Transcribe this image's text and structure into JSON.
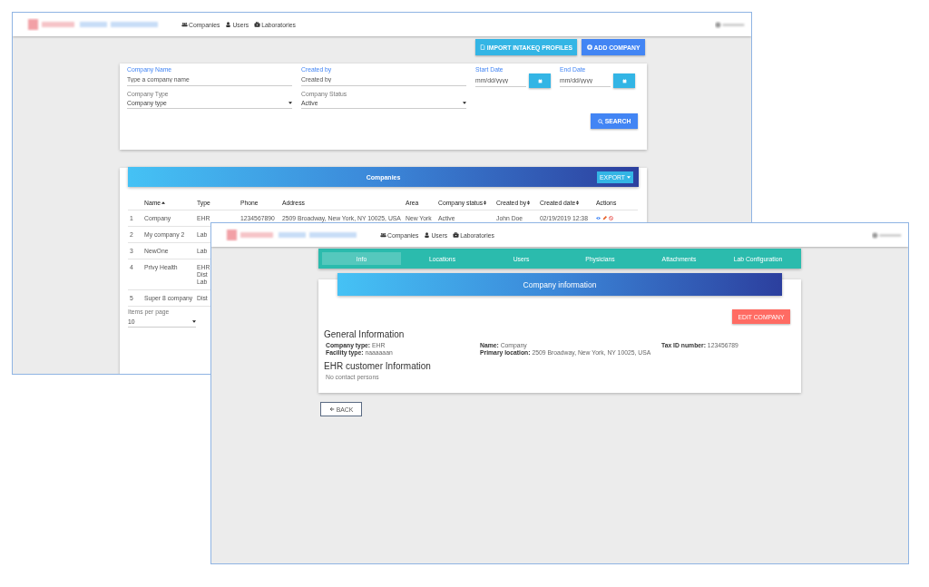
{
  "back_window": {
    "nav": {
      "items": [
        {
          "label": "Companies"
        },
        {
          "label": "Users"
        },
        {
          "label": "Laboratories"
        }
      ]
    },
    "toolbar_buttons": [
      {
        "label": "IMPORT INTAKEQ PROFILES",
        "kind": "import"
      },
      {
        "label": "ADD COMPANY",
        "kind": "add"
      }
    ],
    "filters": {
      "company_name": {
        "label": "Company Name",
        "placeholder": "Type a company name"
      },
      "created_by": {
        "label": "Created by",
        "placeholder": "Created by"
      },
      "start_date": {
        "label": "Start Date",
        "placeholder": "mm/dd/yyyy"
      },
      "end_date": {
        "label": "End Date",
        "placeholder": "mm/dd/yyyy"
      },
      "company_type": {
        "label": "Company Type",
        "value": "Company type"
      },
      "company_status": {
        "label": "Company Status",
        "value": "Active"
      },
      "search_button": "SEARCH"
    },
    "table": {
      "title": "Companies",
      "export_button": "EXPORT",
      "columns": [
        {
          "label": "Name",
          "sortable": true,
          "sorted": true
        },
        {
          "label": "Type",
          "sortable": false,
          "sorted": false
        },
        {
          "label": "Phone",
          "sortable": false,
          "sorted": false
        },
        {
          "label": "Address",
          "sortable": false,
          "sorted": false
        },
        {
          "label": "Area",
          "sortable": false,
          "sorted": false
        },
        {
          "label": "Company status",
          "sortable": true,
          "sorted": false
        },
        {
          "label": "Created by",
          "sortable": true,
          "sorted": false
        },
        {
          "label": "Created date",
          "sortable": true,
          "sorted": false
        },
        {
          "label": "Actions",
          "sortable": false,
          "sorted": false
        }
      ],
      "rows": [
        {
          "number": "1",
          "name": "Company",
          "type": [
            "EHR"
          ],
          "phone": "1234567890",
          "address": "2509 Broadway, New York, NY 10025, USA",
          "area": "New York",
          "status": "Active",
          "created_by": "John Doe",
          "created_date": "02/19/2019 12:38",
          "actions": true
        },
        {
          "number": "2",
          "name": "My company 2",
          "type": [
            "Lab"
          ]
        },
        {
          "number": "3",
          "name": "NewOne",
          "type": [
            "Lab"
          ]
        },
        {
          "number": "4",
          "name": "Privy Health",
          "type": [
            "EHR",
            "Dist",
            "Lab"
          ]
        },
        {
          "number": "5",
          "name": "Super 8 company",
          "type": [
            "Dist"
          ]
        }
      ],
      "items_per_page": {
        "label": "Items per page",
        "value": "10"
      }
    }
  },
  "front_window": {
    "nav": {
      "items": [
        {
          "label": "Companies"
        },
        {
          "label": "Users"
        },
        {
          "label": "Laboratories"
        }
      ]
    },
    "tabs": [
      {
        "label": "Info",
        "selected": true
      },
      {
        "label": "Locations",
        "selected": false
      },
      {
        "label": "Users",
        "selected": false
      },
      {
        "label": "Physicians",
        "selected": false
      },
      {
        "label": "Attachments",
        "selected": false
      },
      {
        "label": "Lab Configuration",
        "selected": false
      }
    ],
    "header": "Company information",
    "edit_button": "EDIT COMPANY",
    "sections": [
      {
        "title": "General Information",
        "kind": "fields",
        "fields": [
          {
            "label": "Company type:",
            "value": "EHR"
          },
          {
            "label": "Name:",
            "value": "Company"
          },
          {
            "label": "Tax ID number:",
            "value": "123456789"
          },
          {
            "label": "Facility type:",
            "value": "naaaaaan"
          },
          {
            "label": "Primary location:",
            "value": "2509 Broadway, New York, NY 10025, USA"
          }
        ]
      },
      {
        "title": "EHR customer Information",
        "kind": "note",
        "note": "No contact persons"
      }
    ],
    "back_button": "BACK"
  }
}
